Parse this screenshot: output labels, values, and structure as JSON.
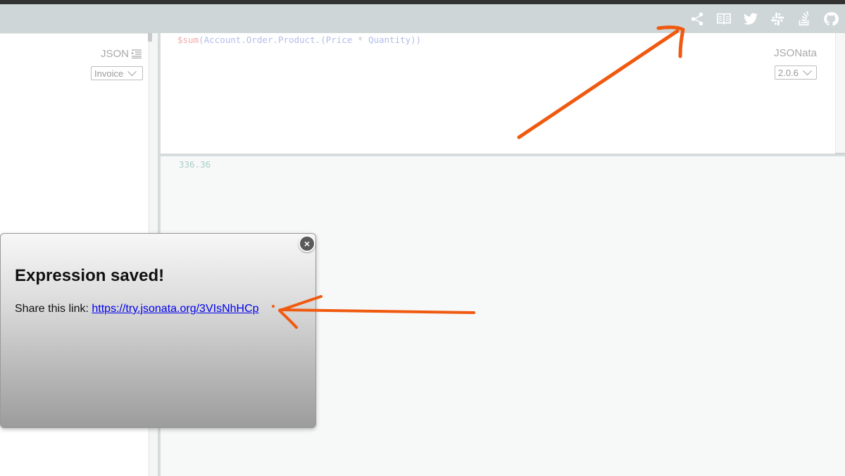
{
  "toolbar": {
    "icons": [
      "share-icon",
      "book-icon",
      "twitter-icon",
      "slack-icon",
      "stackoverflow-icon",
      "github-icon"
    ]
  },
  "input_pane": {
    "label": "JSON",
    "sample_select": "Invoice"
  },
  "expression_pane": {
    "code_fn": "$sum",
    "code_args_1": "(Account.Order.Product.(Price ",
    "code_op": "*",
    "code_args_2": " Quantity))",
    "label": "JSONata",
    "version_select": "2.0.6"
  },
  "result_pane": {
    "value": "336.36"
  },
  "modal": {
    "close_label": "×",
    "title": "Expression saved!",
    "share_prefix": "Share this link:",
    "link": "https://try.jsonata.org/3VIsNhHCp"
  },
  "colors": {
    "annotation_arrow": "#f05a10",
    "toolbar_bg": "#cfd6d8",
    "link": "#0000ee"
  }
}
